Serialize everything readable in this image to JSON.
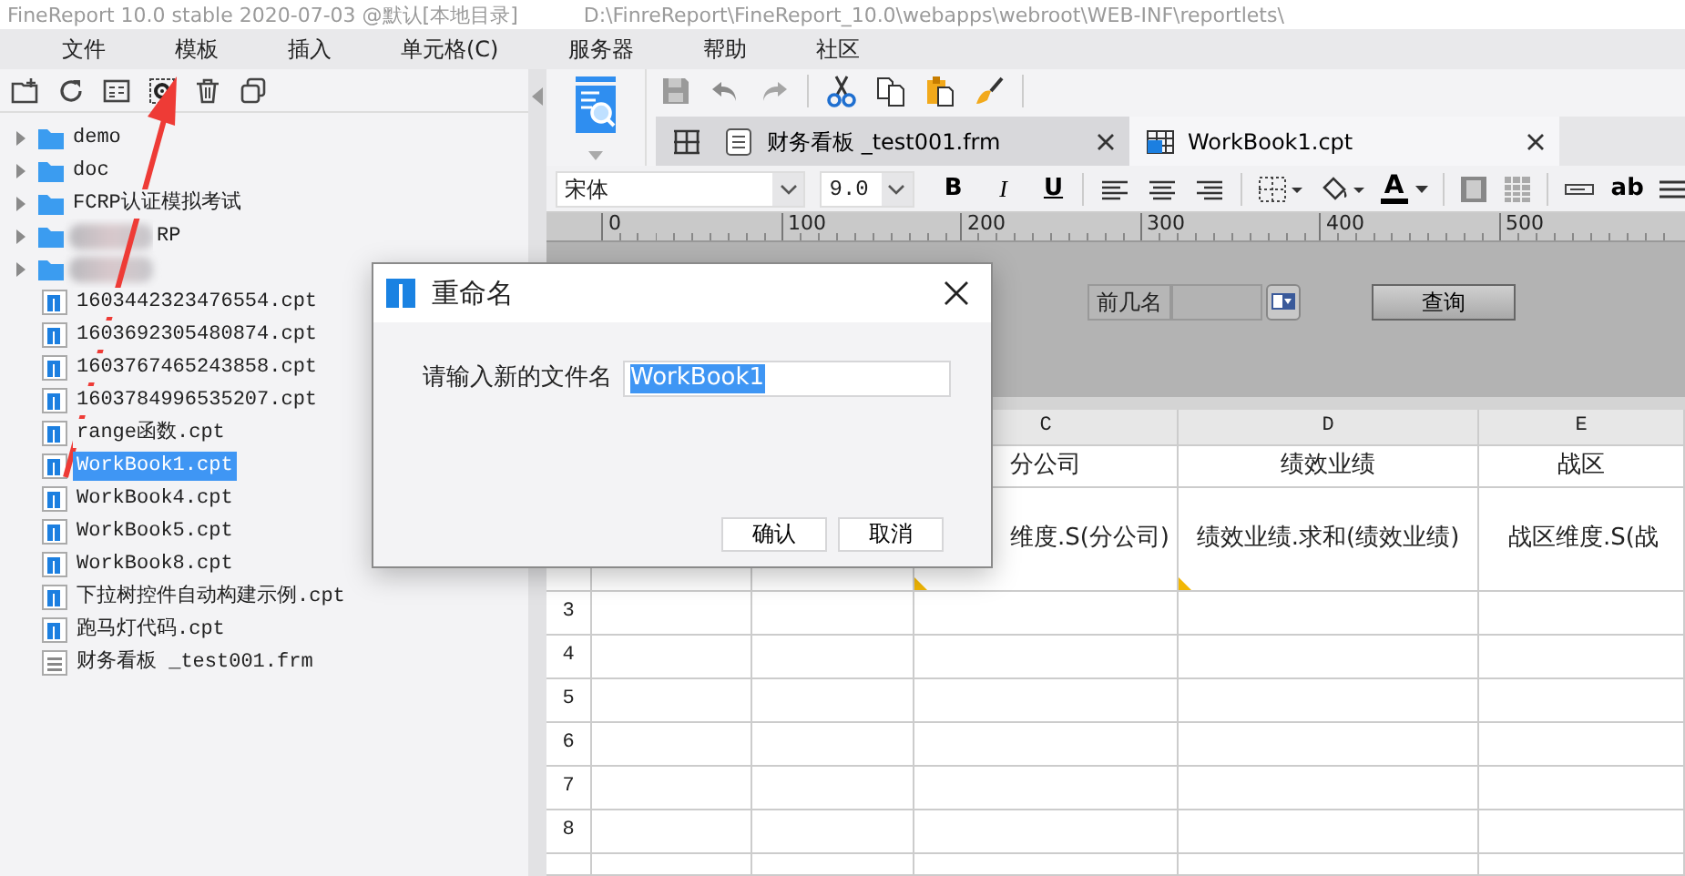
{
  "window": {
    "title": "FineReport 10.0 stable 2020-07-03 @默认[本地目录]",
    "path": "D:\\FinreReport\\FineReport_10.0\\webapps\\webroot\\WEB-INF\\reportlets\\"
  },
  "menu": [
    "文件",
    "模板",
    "插入",
    "单元格(C)",
    "服务器",
    "帮助",
    "社区"
  ],
  "file_tree": [
    {
      "kind": "folder",
      "label": "demo",
      "blurred": false,
      "selected": false
    },
    {
      "kind": "folder",
      "label": "doc",
      "blurred": false,
      "selected": false
    },
    {
      "kind": "folder",
      "label": "FCRP认证模拟考试",
      "blurred": false,
      "selected": false
    },
    {
      "kind": "folder",
      "label": "RP",
      "blurred": true,
      "selected": false
    },
    {
      "kind": "folder",
      "blurred": true,
      "selected": false
    },
    {
      "kind": "report",
      "label": "1603442323476554.cpt",
      "blurred": false,
      "selected": false
    },
    {
      "kind": "report",
      "label": "1603692305480874.cpt",
      "blurred": false,
      "selected": false
    },
    {
      "kind": "report",
      "label": "1603767465243858.cpt",
      "blurred": false,
      "selected": false
    },
    {
      "kind": "report",
      "label": "1603784996535207.cpt",
      "blurred": false,
      "selected": false
    },
    {
      "kind": "report",
      "label": "range函数.cpt",
      "blurred": false,
      "selected": false
    },
    {
      "kind": "report",
      "label": "WorkBook1.cpt",
      "blurred": false,
      "selected": true
    },
    {
      "kind": "report",
      "label": "WorkBook4.cpt",
      "blurred": false,
      "selected": false
    },
    {
      "kind": "report",
      "label": "WorkBook5.cpt",
      "blurred": false,
      "selected": false
    },
    {
      "kind": "report",
      "label": "WorkBook8.cpt",
      "blurred": false,
      "selected": false
    },
    {
      "kind": "report",
      "label": "下拉树控件自动构建示例.cpt",
      "blurred": false,
      "selected": false
    },
    {
      "kind": "report",
      "label": "跑马灯代码.cpt",
      "blurred": false,
      "selected": false
    },
    {
      "kind": "form",
      "label": "财务看板 _test001.frm",
      "blurred": false,
      "selected": false
    }
  ],
  "tabs": [
    {
      "kind": "form",
      "label": "财务看板 _test001.frm",
      "selected": false
    },
    {
      "kind": "report",
      "label": "WorkBook1.cpt",
      "selected": true
    }
  ],
  "format_toolbar": {
    "font": "宋体",
    "size": "9.0",
    "style_buttons": [
      "B",
      "I",
      "U"
    ],
    "font_color_glyph": "A",
    "text_button": "ab"
  },
  "ruler": {
    "ticks": [
      "0",
      "100",
      "200",
      "300",
      "400",
      "500"
    ]
  },
  "parameter_panel": {
    "label": "前几名",
    "button": "查询"
  },
  "sheet": {
    "columns": [
      "C",
      "D",
      "E"
    ],
    "content_rows": [
      [
        "分公司",
        "绩效业绩",
        "战区"
      ],
      [
        "维度.S(分公司)",
        "绩效业绩.求和(绩效业绩)",
        "战区维度.S(战"
      ]
    ],
    "row_numbers": [
      "3",
      "4",
      "5",
      "6",
      "7",
      "8"
    ]
  },
  "dialog": {
    "title": "重命名",
    "label": "请输入新的文件名",
    "value": "WorkBook1",
    "buttons": [
      "确认",
      "取消"
    ]
  }
}
